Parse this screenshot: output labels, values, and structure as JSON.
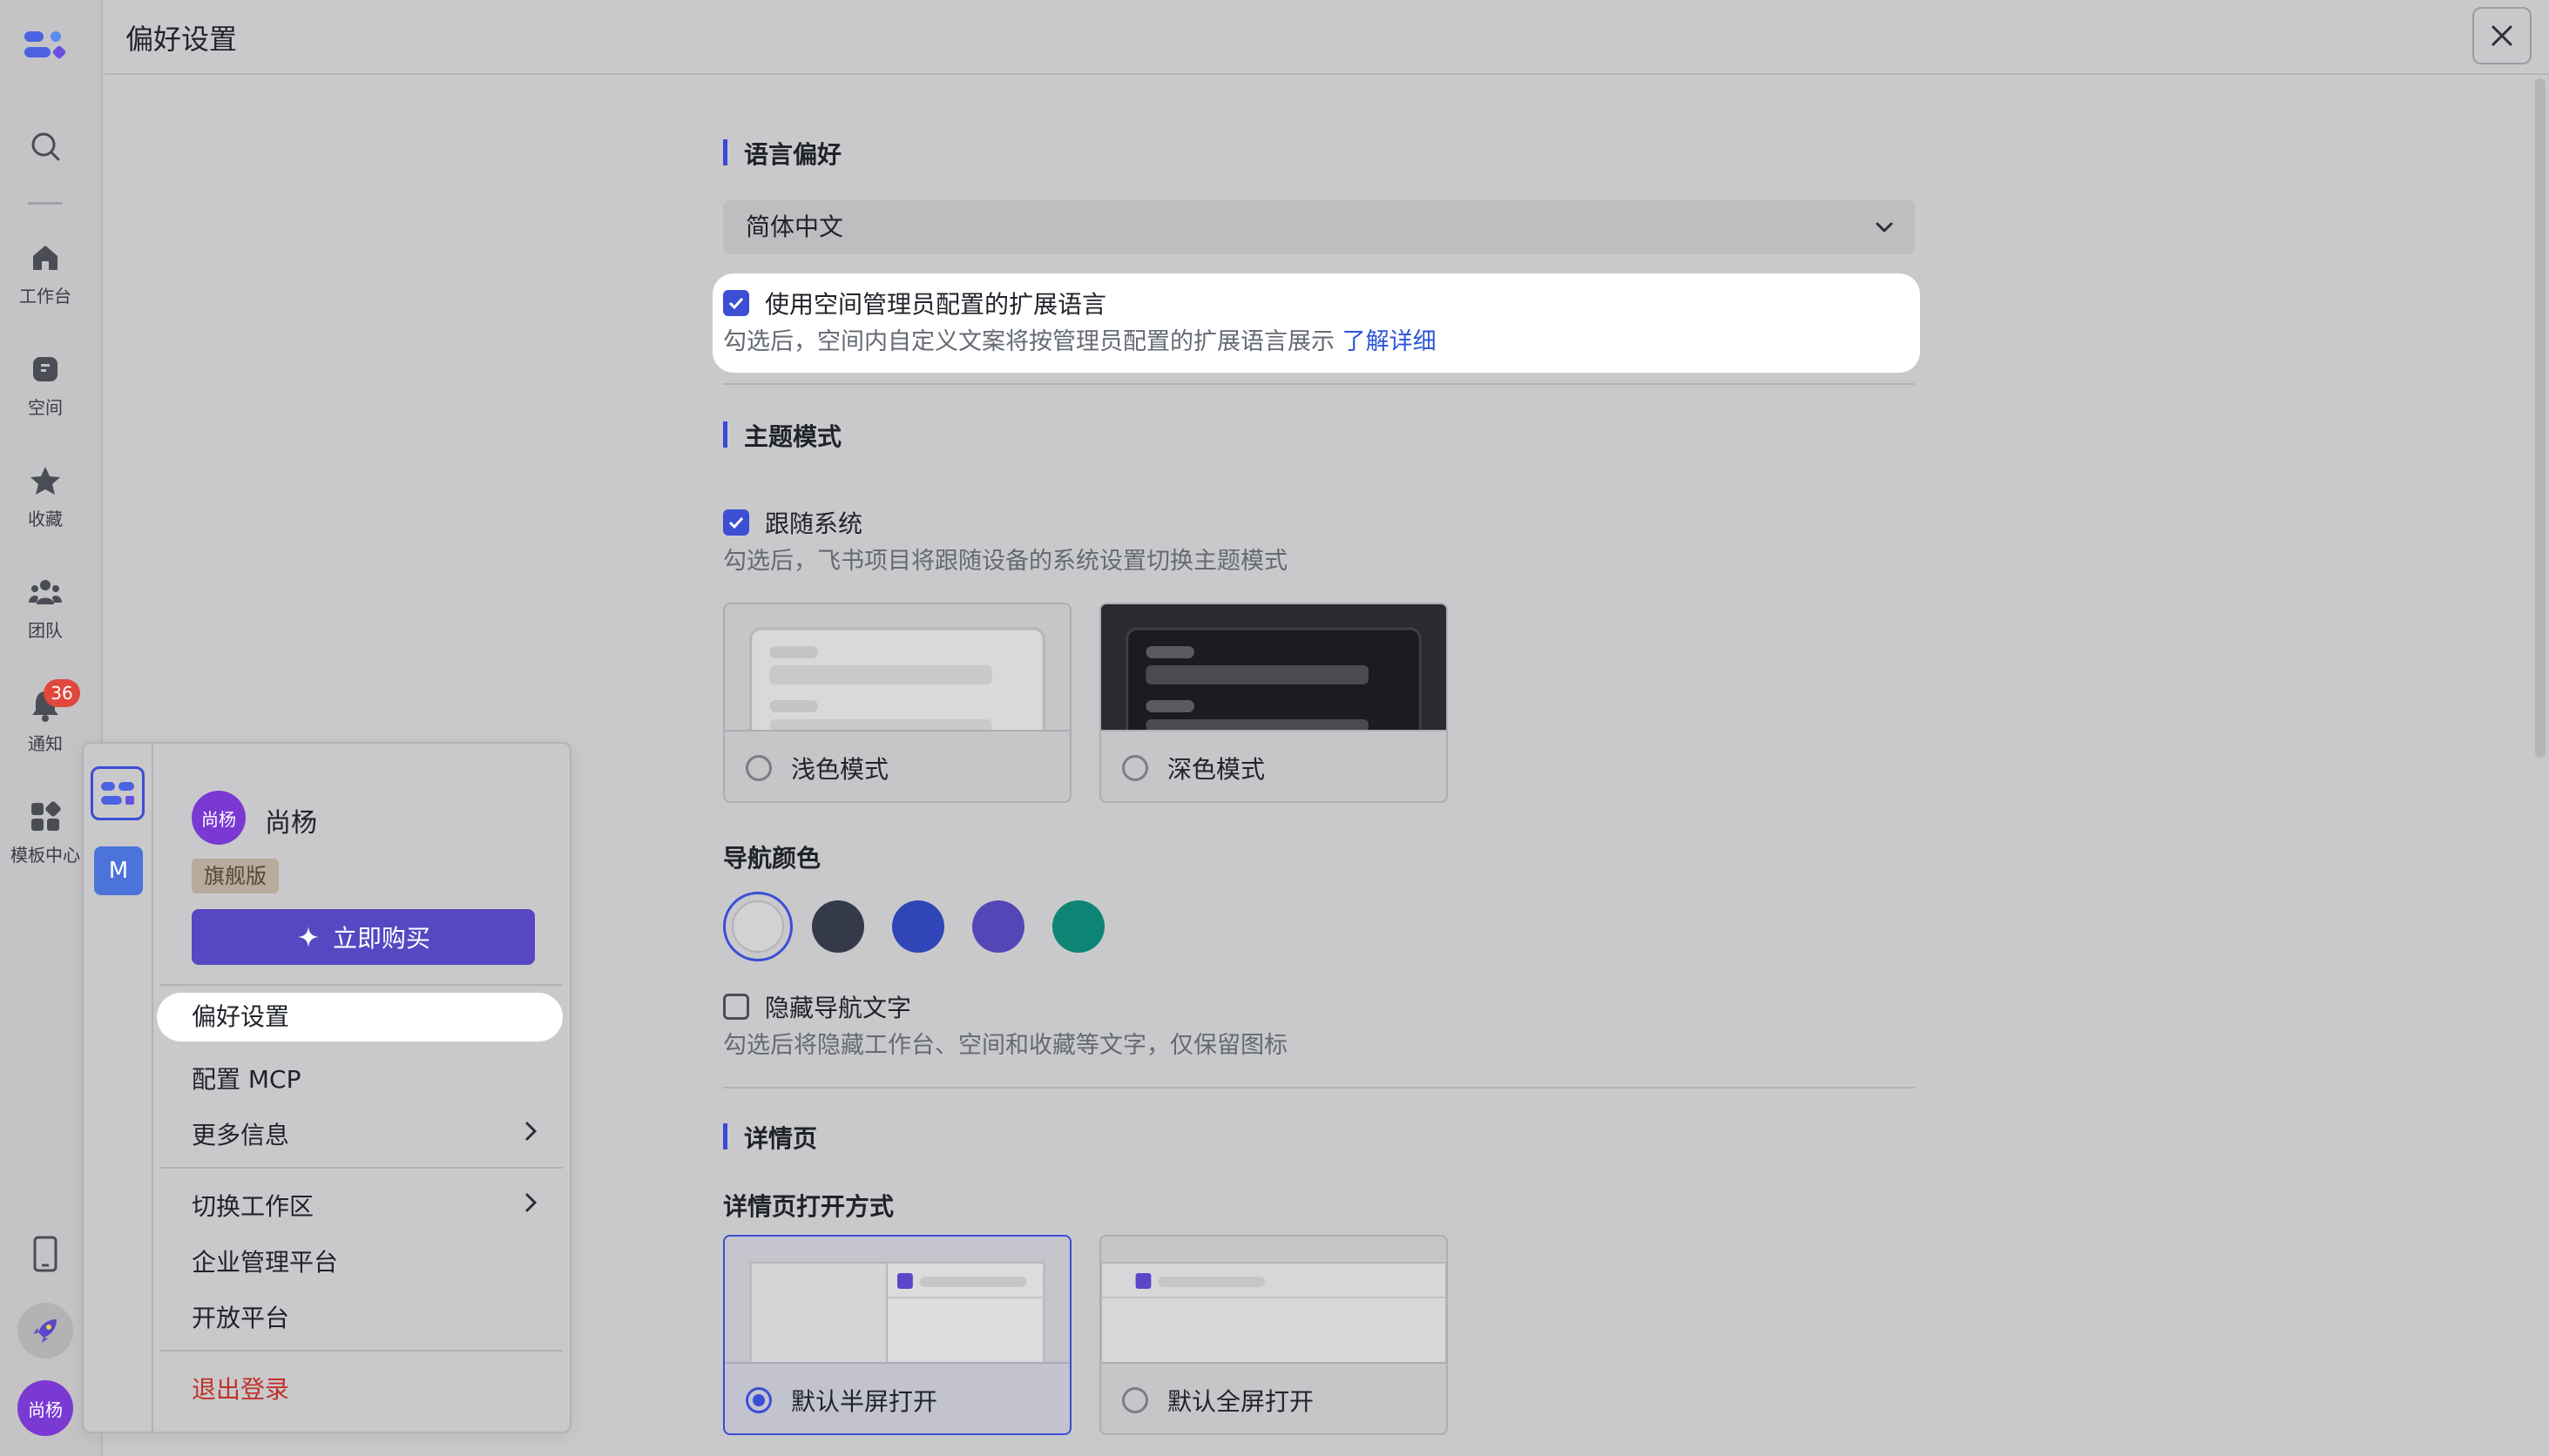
{
  "header": {
    "title": "偏好设置"
  },
  "rail": {
    "items": [
      {
        "label": "工作台"
      },
      {
        "label": "空间"
      },
      {
        "label": "收藏"
      },
      {
        "label": "团队"
      },
      {
        "label": "通知"
      },
      {
        "label": "模板中心"
      }
    ],
    "notification_count": "36",
    "avatar_text": "尚杨"
  },
  "language": {
    "section_title": "语言偏好",
    "selected": "简体中文",
    "ext_checkbox_label": "使用空间管理员配置的扩展语言",
    "ext_desc": "勾选后，空间内自定义文案将按管理员配置的扩展语言展示",
    "learn_more": "了解详细"
  },
  "theme": {
    "section_title": "主题模式",
    "follow_system_label": "跟随系统",
    "follow_system_desc": "勾选后，飞书项目将跟随设备的系统设置切换主题模式",
    "light_label": "浅色模式",
    "dark_label": "深色模式",
    "nav_color_title": "导航颜色",
    "nav_colors": [
      "#d2d2d4",
      "#353a4a",
      "#2f45b8",
      "#5546b8",
      "#0e8474"
    ],
    "hide_nav_text_label": "隐藏导航文字",
    "hide_nav_text_desc": "勾选后将隐藏工作台、空间和收藏等文字，仅保留图标"
  },
  "detail": {
    "section_title": "详情页",
    "open_mode_title": "详情页打开方式",
    "half_label": "默认半屏打开",
    "full_label": "默认全屏打开"
  },
  "popover": {
    "workspace_initial": "M",
    "avatar_text": "尚杨",
    "user_name": "尚杨",
    "plan_tag": "旗舰版",
    "buy_label": "立即购买",
    "menu": {
      "preferences": "偏好设置",
      "mcp": "配置 MCP",
      "more_info": "更多信息",
      "switch_workspace": "切换工作区",
      "enterprise_admin": "企业管理平台",
      "open_platform": "开放平台",
      "logout": "退出登录"
    }
  }
}
